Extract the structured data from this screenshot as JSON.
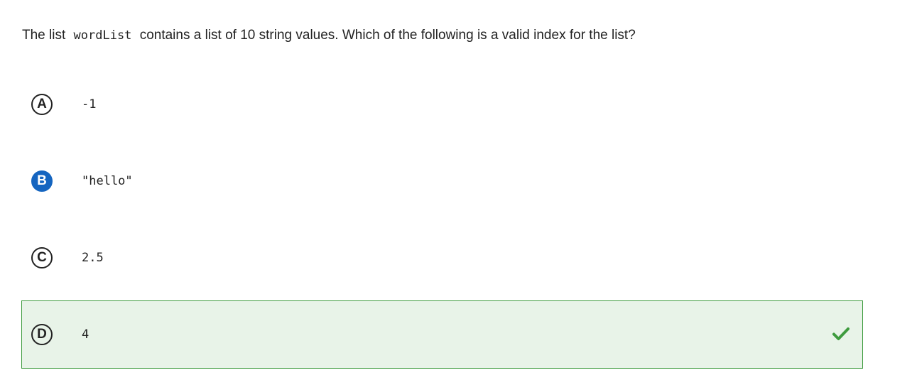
{
  "question": {
    "prefix": "The list",
    "code": "wordList",
    "suffix": "contains a list of 10 string values. Which of the following is a valid index for the list?"
  },
  "options": [
    {
      "letter": "A",
      "text": "-1",
      "selected": false,
      "correct": false
    },
    {
      "letter": "B",
      "text": "\"hello\"",
      "selected": true,
      "correct": false
    },
    {
      "letter": "C",
      "text": "2.5",
      "selected": false,
      "correct": false
    },
    {
      "letter": "D",
      "text": "4",
      "selected": false,
      "correct": true
    }
  ],
  "icons": {
    "correct_indicator": "checkmark-icon"
  },
  "colors": {
    "selected_badge": "#1565c0",
    "correct_background": "#e8f3e8",
    "correct_border": "#3e9b3e",
    "checkmark": "#3e9b3e"
  }
}
